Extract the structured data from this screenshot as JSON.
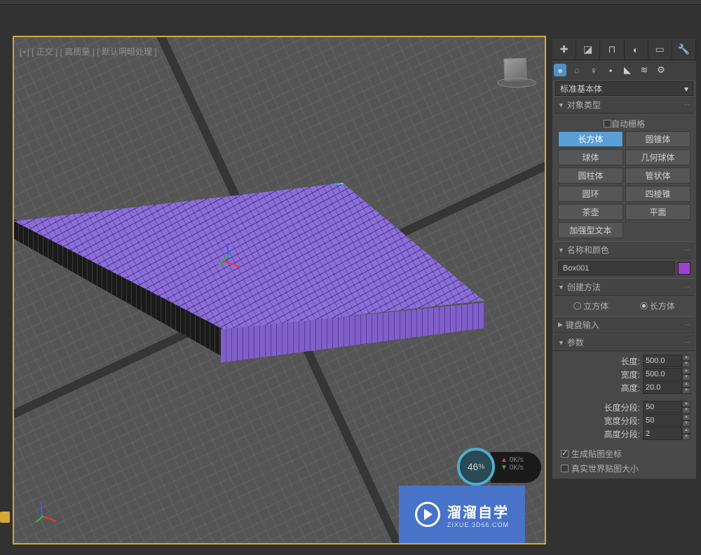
{
  "viewport": {
    "label": "[+] [ 正交 ] [ 高质量 ] [ 默认明暗处理 ]"
  },
  "speed": {
    "percent": "46",
    "pct_suffix": "%",
    "up": "0K/s",
    "down": "0K/s"
  },
  "watermark": {
    "title": "溜溜自学",
    "sub": "ZIXUE.3D66.COM"
  },
  "panel": {
    "category": "标准基本体",
    "objType": {
      "title": "对象类型",
      "autoGrid": "自动栅格",
      "buttons": [
        "长方体",
        "圆锥体",
        "球体",
        "几何球体",
        "圆柱体",
        "管状体",
        "圆环",
        "四棱锥",
        "茶壶",
        "平面",
        "加强型文本"
      ]
    },
    "nameColor": {
      "title": "名称和颜色",
      "value": "Box001"
    },
    "createMethod": {
      "title": "创建方法",
      "cube": "立方体",
      "box": "长方体"
    },
    "keyboard": {
      "title": "键盘输入"
    },
    "params": {
      "title": "参数",
      "length_lbl": "长度:",
      "length": "500.0",
      "width_lbl": "宽度:",
      "width": "500.0",
      "height_lbl": "高度:",
      "height": "20.0",
      "lengthSeg_lbl": "长度分段:",
      "lengthSeg": "50",
      "widthSeg_lbl": "宽度分段:",
      "widthSeg": "50",
      "heightSeg_lbl": "高度分段:",
      "heightSeg": "2",
      "genMap": "生成贴图坐标",
      "realWorld": "真实世界贴图大小"
    }
  }
}
